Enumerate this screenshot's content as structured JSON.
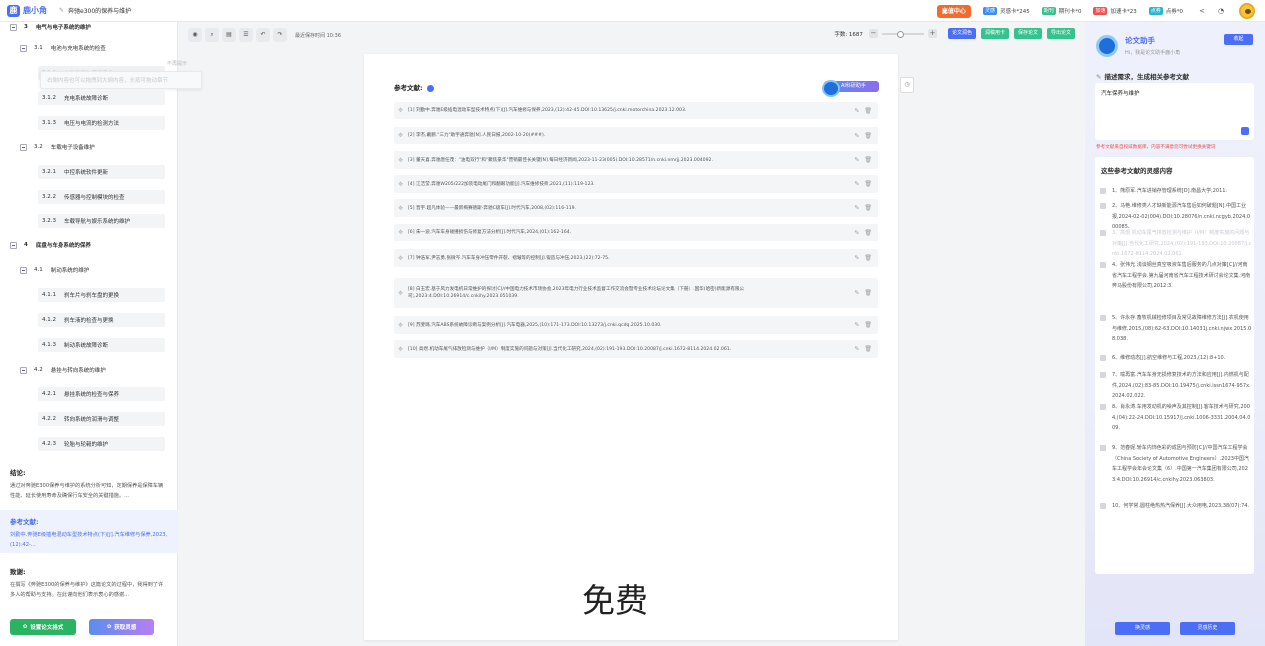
{
  "app": {
    "logo_text": "鹿小角",
    "doc_title": "奔驰e300的保养与维护"
  },
  "topbar": {
    "recharge_label": "充值中心",
    "cards": [
      {
        "badge": "灵感",
        "label": "灵感卡*245",
        "color": "#3a8cf0"
      },
      {
        "badge": "期刊",
        "label": "期刊卡*0",
        "color": "#34c38f"
      },
      {
        "badge": "加速",
        "label": "加速卡*23",
        "color": "#f05050"
      },
      {
        "badge": "点券",
        "label": "点券*0",
        "color": "#22b8cf"
      }
    ]
  },
  "outline": {
    "items": [
      {
        "num": "3",
        "label": "电气与电子系统的维护",
        "level": 1
      },
      {
        "num": "3.1",
        "label": "电池与充电系统的检查",
        "level": 2
      },
      {
        "num": "3.1.1",
        "label": "电池性能与使用寿命",
        "level": 3
      },
      {
        "num": "3.1.2",
        "label": "充电系统故障诊断",
        "level": 3
      },
      {
        "num": "3.1.3",
        "label": "电压与电流的检测方法",
        "level": 3
      },
      {
        "num": "3.2",
        "label": "车载电子设备维护",
        "level": 2
      },
      {
        "num": "3.2.1",
        "label": "中控系统软件更新",
        "level": 3
      },
      {
        "num": "3.2.2",
        "label": "传感器与控制模块的检查",
        "level": 3
      },
      {
        "num": "3.2.3",
        "label": "车载导航与娱乐系统的维护",
        "level": 3
      },
      {
        "num": "4",
        "label": "底盘与车身系统的保养",
        "level": 1
      },
      {
        "num": "4.1",
        "label": "制动系统的维护",
        "level": 2
      },
      {
        "num": "4.1.1",
        "label": "刹车片与刹车盘的更换",
        "level": 3
      },
      {
        "num": "4.1.2",
        "label": "刹车液的检查与更换",
        "level": 3
      },
      {
        "num": "4.1.3",
        "label": "制动系统故障诊断",
        "level": 3
      },
      {
        "num": "4.2",
        "label": "悬挂与转向系统的维护",
        "level": 2
      },
      {
        "num": "4.2.1",
        "label": "悬挂系统的检查与保养",
        "level": 3
      },
      {
        "num": "4.2.2",
        "label": "转向系统的润滑与调整",
        "level": 3
      },
      {
        "num": "4.2.3",
        "label": "轮胎与轮毂的维护",
        "level": 3
      }
    ],
    "drag_tip": "右侧内容也可以拖拽到大纲内容，长按可拖动章节",
    "drag_tip_flag": "不再提示"
  },
  "sections": {
    "conclusion": {
      "title": "结论:",
      "text": "通过对奔驰E300保养与维护的系统分析可知，定期保养是保障车辆性能、延长使用寿命及确保行车安全的关键措施。..."
    },
    "references": {
      "title": "参考文献:",
      "text": "刘勤中.奔驰E级插电混动车型技术特点(下)[J].汽车维修与保养,2023,(12):42-..."
    },
    "thanks": {
      "title": "致谢:",
      "text": "在撰写《奔驰E300的保养与维护》这篇论文的过程中，我得到了许多人的帮助与支持。在此谨向他们表示衷心的感谢..."
    }
  },
  "left_buttons": {
    "format": "设置论文格式",
    "inspire": "获取灵感"
  },
  "toolbar": {
    "save_time": "最近保存时间 10:36",
    "word_count": "字数: 1687",
    "actions": [
      {
        "label": "论文润色",
        "color": "#4c6ef5"
      },
      {
        "label": "润稿用卡",
        "color": "#34c38f"
      },
      {
        "label": "保存论文",
        "color": "#34c38f"
      },
      {
        "label": "导出论文",
        "color": "#34c38f"
      }
    ]
  },
  "paper": {
    "ref_heading": "参考文献:",
    "ai_button": "AI科研助手",
    "references": [
      "[1] 刘勤中.奔驰E级插电混动车型技术特点(下)[J].汽车维修与保养,2023,(12):42-45.DOI:10.13625/j.cnki.motorchina.2023.12.003.",
      "[2] 李杰,戴鹏.\"三力\"助宇通奔驰[N].人民日报,2002-10-20(###).",
      "[3] 董天喜.奔驰唐任茂：\"油电双行\"和\"聚焦豪华\"营销最佳长关键[N].每日经济新闻,2023-11-23(005).DOI:10.28571/n.cnki.nmrjj.2023.004092.",
      "[4] 江洁莹.奔驰W205/222加装电动尾门和翻眼功能[J].汽车维修技师,2021,(11):119-123.",
      "[5] 晋宇.超凡体验——最新梅赛德斯-奔驰C级车[J].时代汽车,2008,(02):116-119.",
      "[6] 朱一迪.汽车车身碰撞损伤与修复方法分析[J].时代汽车,2024,(01):162-164.",
      "[7] 钟浩军,尹志勇,张微岑.汽车车身冲压零件开裂、褶皱等的控制[J].锻造与冲压,2023,(22):72-75.",
      "[8] 白玉宏.基于风力发电机日常维护的探讨[C]//中国电力技术市场协会,2023年电力行业技术监督工作交流会暨专业技术论坛论文集（下册）.国华(哈密)新能源有限公司;,2023:4.DOI:10.26914/c.cnkihy.2023.051039.",
      "[9] 苏斐璐.汽车ABS系统故障诊断与案例分析[J].汽车电器,2025,(10):171-173.DOI:10.13273/j.cnki.qcdq.2025.10.030.",
      "[10] 高煜.机动车尾气排放检测与维护（I/M）制度实施的问题与对策[J].当代化工研究,2024,(02):191-193.DOI:10.20087/j.cnki.1672-8114.2024.02.061."
    ],
    "watermark": "免费"
  },
  "assistant": {
    "name": "论文助手",
    "subtitle": "Hi，我是论文助手鹿小角",
    "collapse": "收起",
    "prompt_title": "描述需求，生成相关参考文献",
    "input_value": "汽车保养与维护",
    "warning": "参考文献来自权威数据库，内容不满意您可尝试更换关键词",
    "list_title": "这些参考文献的灵感内容",
    "items": [
      "1、熊原军.汽车进销存管理系统[D].南昌大学,2011.",
      "2、马艳.维修类人才缺新能源汽车售后如何破题[N].中国工业报,2024-02-02(004).DOI:10.28076/n.cnki.ncgyb.2024.000085.",
      "3、高煜.机动车尾气排放检测与维护（I/M）制度实施的问题与对策[J].当代化工研究,2024,(02):191-193.DOI:10.20087/j.cnki.1672-8114.2024.02.061.",
      "4、张伟光.浅谈钢丝真空吸液车售后服务的几点对策[C]//河南省汽车工程学会.第九届河南省汽车工程技术研讨会论文集.河南奔马股份有限公司,2012:3.",
      "5、许永存.畜牧机械检修项目及常见故障维修方法[J].农机使用与维修,2015,(08):62-63.DOI:10.14031j.cnki.njwx.2015.08.038.",
      "6、维修动态[J].航空维修与工程,2023,(12):8+10.",
      "7、喻再富.汽车车身无损修复技术的方法和应用[J].内燃机与配件,2024,(02):83-85.DOI:10.19475/j.cnki.issn1674-957x.2024.02.022.",
      "8、肖永涛.车用发动机的噪声及其控制[J].客车技术与研究,2004,(04):22-24.DOI:10.15917/j.cnki.1006-3331.2004.04.009.",
      "9、范春妮.轿车内饰色彩的成因与预防[C]//中国汽车工程学会（China Society of Automotive Engineers）.2023中国汽车工程学会年会论文集（6）.中国第一汽车集团有限公司,2023:4.DOI:10.26914/c.cnkihy.2023.063803.",
      "10、何学常.圆柱绝热热汽保养[J].大众用电,2023,38(07):74."
    ],
    "btn_change": "换灵感",
    "btn_history": "灵感历史"
  }
}
